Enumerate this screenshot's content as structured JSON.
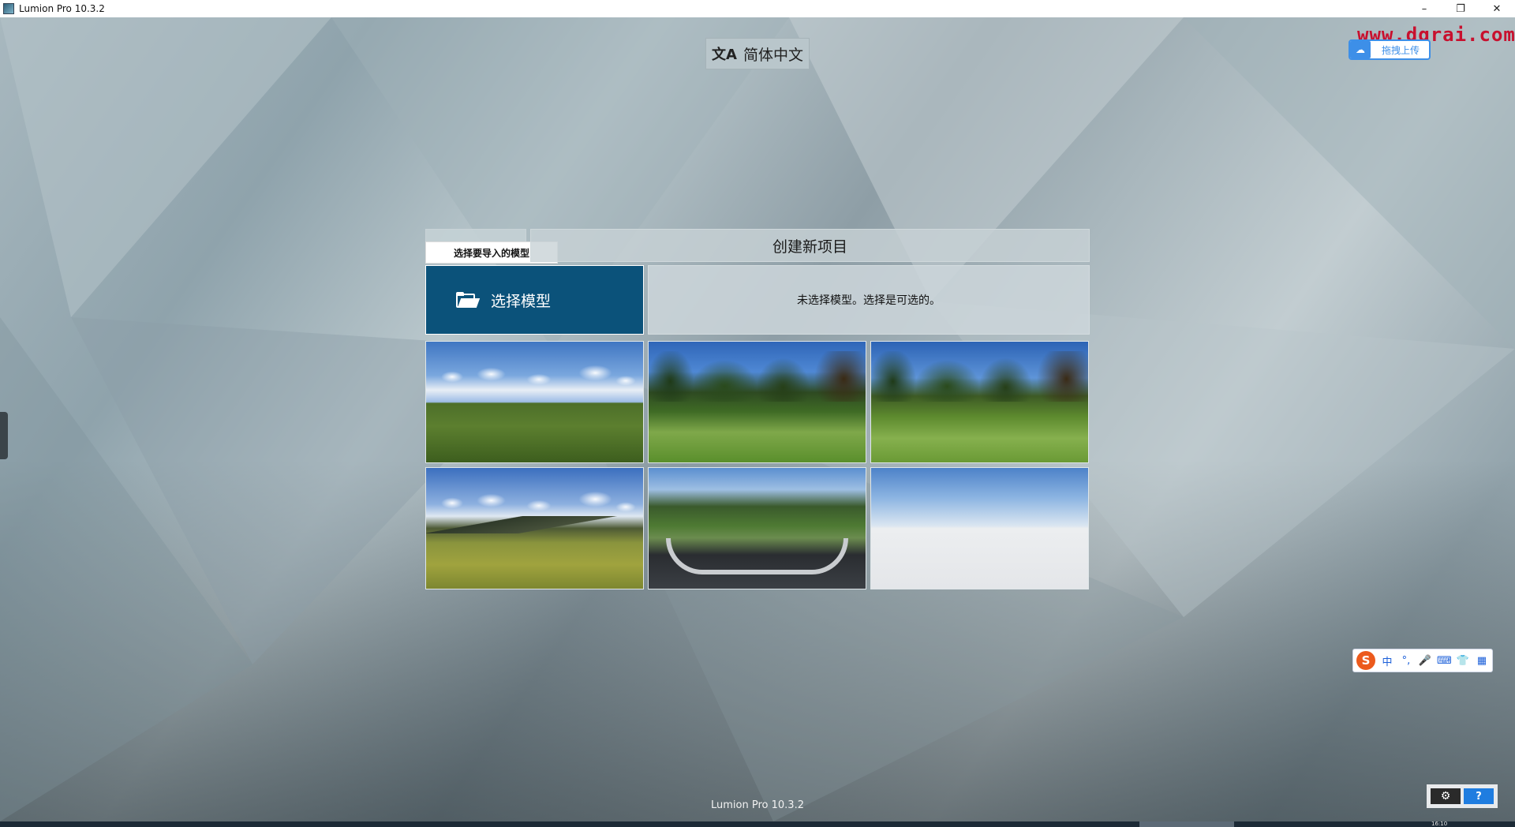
{
  "window": {
    "title": "Lumion Pro 10.3.2",
    "controls": [
      "–",
      "❐",
      "✕"
    ]
  },
  "language": {
    "label": "简体中文",
    "icon": "translate-icon"
  },
  "overlay": {
    "watermark": "www.dgrai.com",
    "upload_label": "拖拽上传",
    "upload_icon": "baidu-cloud-icon"
  },
  "project": {
    "tab_label": "选择要导入的模型",
    "header_title": "创建新项目",
    "select_model_label": "选择模型",
    "info_text": "未选择模型。选择是可选的。",
    "templates": [
      {
        "name": "template-grass-field"
      },
      {
        "name": "template-forest-meadow"
      },
      {
        "name": "template-tropical-meadow"
      },
      {
        "name": "template-hills-field"
      },
      {
        "name": "template-roundabout-park"
      },
      {
        "name": "template-blank-sky"
      }
    ]
  },
  "footer": {
    "version": "Lumion Pro 10.3.2"
  },
  "ime": {
    "logo": "S",
    "mode": "中",
    "punct": "°,",
    "icons": [
      "microphone-icon",
      "keyboard-icon",
      "skin-icon",
      "toolbox-icon"
    ]
  },
  "tools": {
    "settings_glyph": "⚙",
    "help_glyph": "?"
  },
  "taskbar": {
    "clock": "16:10"
  },
  "colors": {
    "accent": "#0b527a",
    "help": "#1f7de0",
    "watermark": "#c8102e"
  }
}
